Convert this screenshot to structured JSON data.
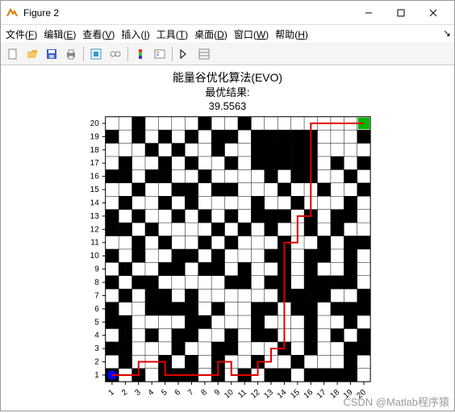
{
  "window": {
    "title": "Figure 2",
    "min_tip": "最小化",
    "max_tip": "最大化",
    "close_tip": "关闭"
  },
  "menu": {
    "file": {
      "label": "文件",
      "key": "F"
    },
    "edit": {
      "label": "编辑",
      "key": "E"
    },
    "view": {
      "label": "查看",
      "key": "V"
    },
    "insert": {
      "label": "插入",
      "key": "I"
    },
    "tools": {
      "label": "工具",
      "key": "T"
    },
    "desktop": {
      "label": "桌面",
      "key": "D"
    },
    "window": {
      "label": "窗口",
      "key": "W"
    },
    "help": {
      "label": "帮助",
      "key": "H"
    }
  },
  "toolbar": {
    "new": "新建",
    "open": "打开",
    "save": "保存",
    "print": "打印",
    "datacursor": "数据游标",
    "link": "链接",
    "colorbar": "颜色栏",
    "legend": "图例",
    "edit": "编辑绘图",
    "prop": "属性"
  },
  "watermark": "CSDN @Matlab程序猿",
  "chart_data": {
    "type": "heatmap",
    "title": "能量谷优化算法(EVO)",
    "subtitle": "最优结果:",
    "result_value": "39.5563",
    "xlabel": "",
    "ylabel": "",
    "grid_size": 20,
    "xticks": [
      1,
      2,
      3,
      4,
      5,
      6,
      7,
      8,
      9,
      10,
      11,
      12,
      13,
      14,
      15,
      16,
      17,
      18,
      19,
      20
    ],
    "yticks": [
      1,
      2,
      3,
      4,
      5,
      6,
      7,
      8,
      9,
      10,
      11,
      12,
      13,
      14,
      15,
      16,
      17,
      18,
      19,
      20
    ],
    "xlim": [
      0.5,
      20.5
    ],
    "ylim": [
      0.5,
      20.5
    ],
    "start": {
      "x": 1,
      "y": 1,
      "color": "#0000ff"
    },
    "goal": {
      "x": 20,
      "y": 20,
      "color": "#00b400"
    },
    "path_color": "#e00000",
    "path": [
      [
        1,
        1
      ],
      [
        2,
        1
      ],
      [
        3,
        1
      ],
      [
        3,
        2
      ],
      [
        4,
        2
      ],
      [
        5,
        2
      ],
      [
        5,
        1
      ],
      [
        6,
        1
      ],
      [
        7,
        1
      ],
      [
        8,
        1
      ],
      [
        9,
        1
      ],
      [
        9,
        2
      ],
      [
        10,
        2
      ],
      [
        10,
        1
      ],
      [
        11,
        1
      ],
      [
        12,
        1
      ],
      [
        12,
        2
      ],
      [
        13,
        2
      ],
      [
        13,
        3
      ],
      [
        14,
        3
      ],
      [
        14,
        4
      ],
      [
        14,
        5
      ],
      [
        14,
        6
      ],
      [
        14,
        7
      ],
      [
        14,
        8
      ],
      [
        14,
        9
      ],
      [
        14,
        10
      ],
      [
        14,
        11
      ],
      [
        15,
        11
      ],
      [
        15,
        12
      ],
      [
        15,
        13
      ],
      [
        16,
        13
      ],
      [
        16,
        14
      ],
      [
        16,
        15
      ],
      [
        16,
        16
      ],
      [
        16,
        17
      ],
      [
        16,
        18
      ],
      [
        16,
        19
      ],
      [
        16,
        20
      ],
      [
        17,
        20
      ],
      [
        18,
        20
      ],
      [
        19,
        20
      ],
      [
        20,
        20
      ]
    ],
    "obstacles": [
      "10101110101011011110",
      "01001010100100100010",
      "11000100110001010011",
      "01010110010110010101",
      "11000011000100010010",
      "10011110100110110111",
      "01011010000001111001",
      "10110000011011011110",
      "01001101101001010010",
      "10100110100011011010",
      "00101001010001001011",
      "11010000101010010100",
      "10100101010111010110",
      "01001010000100100010",
      "00100110110001001001",
      "11011001000010110010",
      "01001010010111110101",
      "00010100100111110000",
      "10101010110111110001",
      "00100001001000000000"
    ]
  }
}
